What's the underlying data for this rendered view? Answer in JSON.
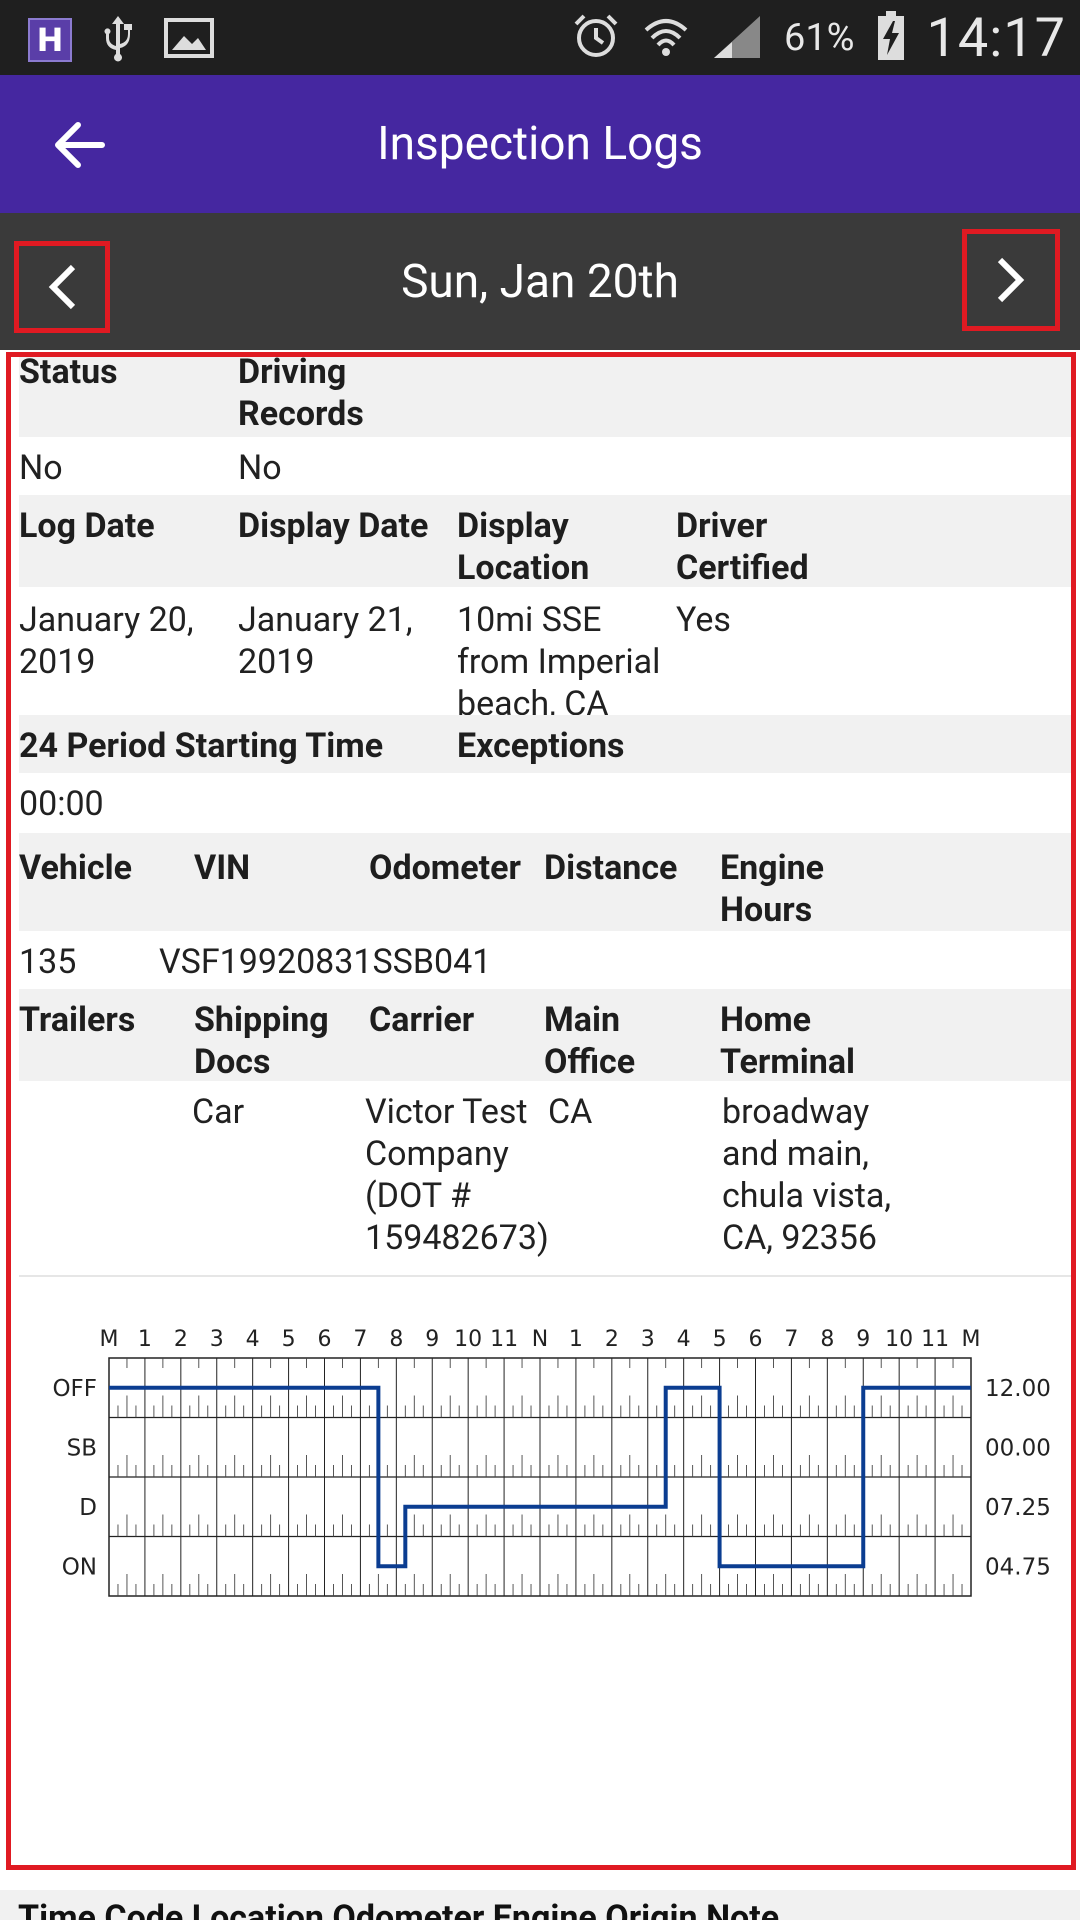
{
  "status_bar": {
    "app_icon": "H",
    "icons": [
      "usb-icon",
      "image-icon",
      "alarm-icon",
      "wifi-icon",
      "signal-icon",
      "battery-charging-icon"
    ],
    "battery": "61%",
    "time": "14:17"
  },
  "appbar": {
    "title": "Inspection Logs"
  },
  "datebar": {
    "date": "Sun, Jan 20th"
  },
  "sections": {
    "status_hdr": {
      "status": "Status",
      "driving_records": "Driving Records"
    },
    "status_vals": {
      "status": "No",
      "driving_records": "No"
    },
    "log_hdr": {
      "log_date": "Log Date",
      "display_date": "Display Date",
      "display_location": "Display Location",
      "driver_certified": "Driver Certified"
    },
    "log_vals": {
      "log_date": "January 20, 2019",
      "display_date": "January 21, 2019",
      "display_location": "10mi SSE from Imperial beach, CA",
      "driver_certified": "Yes"
    },
    "period_hdr": {
      "start_time": "24 Period Starting Time",
      "exceptions": "Exceptions"
    },
    "period_vals": {
      "start_time": "00:00",
      "exceptions": ""
    },
    "vehicle_hdr": {
      "vehicle": "Vehicle",
      "vin": "VIN",
      "odometer": "Odometer",
      "distance": "Distance",
      "engine_hours": "Engine Hours"
    },
    "vehicle_vals": {
      "vehicle": "135",
      "vin": "VSF19920831SSB041",
      "odometer": "",
      "distance": "",
      "engine_hours": ""
    },
    "trailer_hdr": {
      "trailers": "Trailers",
      "shipping_docs": "Shipping Docs",
      "carrier": "Carrier",
      "main_office": "Main Office",
      "home_terminal": "Home Terminal"
    },
    "trailer_vals": {
      "trailers": "",
      "shipping_docs": "Car",
      "carrier": "Victor Test Company (DOT # 159482673)",
      "main_office": "CA",
      "home_terminal": "broadway and main, chula vista, CA, 92356"
    }
  },
  "chart_data": {
    "type": "line",
    "title": "",
    "hour_labels": [
      "M",
      "1",
      "2",
      "3",
      "4",
      "5",
      "6",
      "7",
      "8",
      "9",
      "10",
      "11",
      "N",
      "1",
      "2",
      "3",
      "4",
      "5",
      "6",
      "7",
      "8",
      "9",
      "10",
      "11",
      "M"
    ],
    "status_rows": [
      "OFF",
      "SB",
      "D",
      "ON"
    ],
    "totals": [
      "12.00",
      "00.00",
      "07.25",
      "04.75"
    ],
    "series": [
      {
        "color": "#0b3d91",
        "points": [
          {
            "hour": 0,
            "status": "OFF"
          },
          {
            "hour": 7.5,
            "status": "OFF"
          },
          {
            "hour": 7.5,
            "status": "ON"
          },
          {
            "hour": 8.25,
            "status": "ON"
          },
          {
            "hour": 8.25,
            "status": "D"
          },
          {
            "hour": 15.5,
            "status": "D"
          },
          {
            "hour": 15.5,
            "status": "OFF"
          },
          {
            "hour": 17,
            "status": "OFF"
          },
          {
            "hour": 17,
            "status": "ON"
          },
          {
            "hour": 21,
            "status": "ON"
          },
          {
            "hour": 21,
            "status": "OFF"
          },
          {
            "hour": 24,
            "status": "OFF"
          }
        ]
      }
    ]
  },
  "bottom_strip": {
    "text": "Time  Code  Location  Odometer  Engine  Origin  Note"
  },
  "colors": {
    "appbar": "#4527a0",
    "datebar": "#3a3a3a",
    "highlight": "#e01a22",
    "line": "#0b3d91"
  }
}
